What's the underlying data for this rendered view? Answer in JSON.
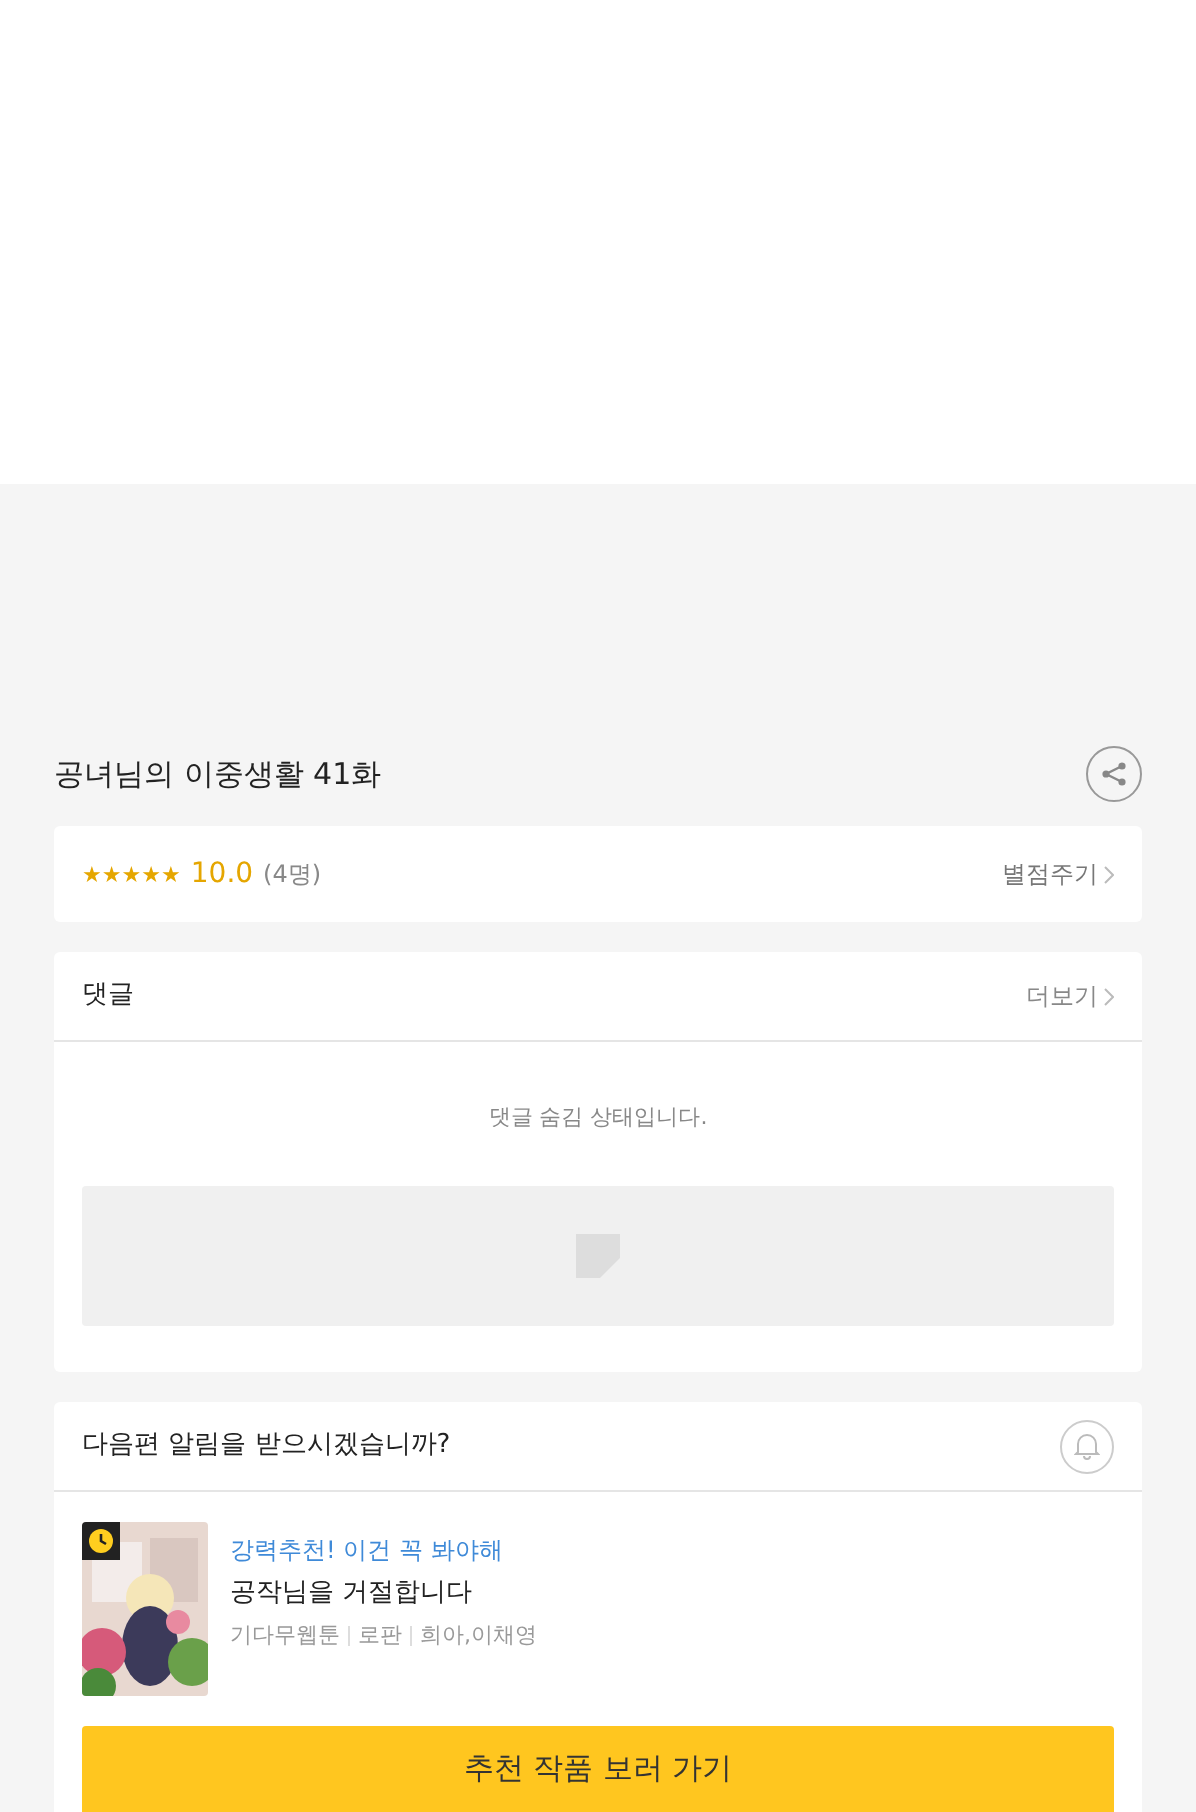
{
  "episode": {
    "title": "공녀님의 이중생활 41화"
  },
  "rating": {
    "stars": 5,
    "score": "10.0",
    "count": "(4명)",
    "action": "별점주기"
  },
  "comments": {
    "title": "댓글",
    "more": "더보기",
    "message": "댓글 숨김 상태입니다."
  },
  "notification": {
    "question": "다음편 알림을 받으시겠습니까?",
    "on": false
  },
  "recommendation": {
    "tag": "강력추천! 이건 꼭 봐야해",
    "title": "공작님을 거절합니다",
    "meta": [
      "기다무웹툰",
      "로판",
      "희아,이채영"
    ],
    "button": "추천 작품 보러 가기"
  }
}
